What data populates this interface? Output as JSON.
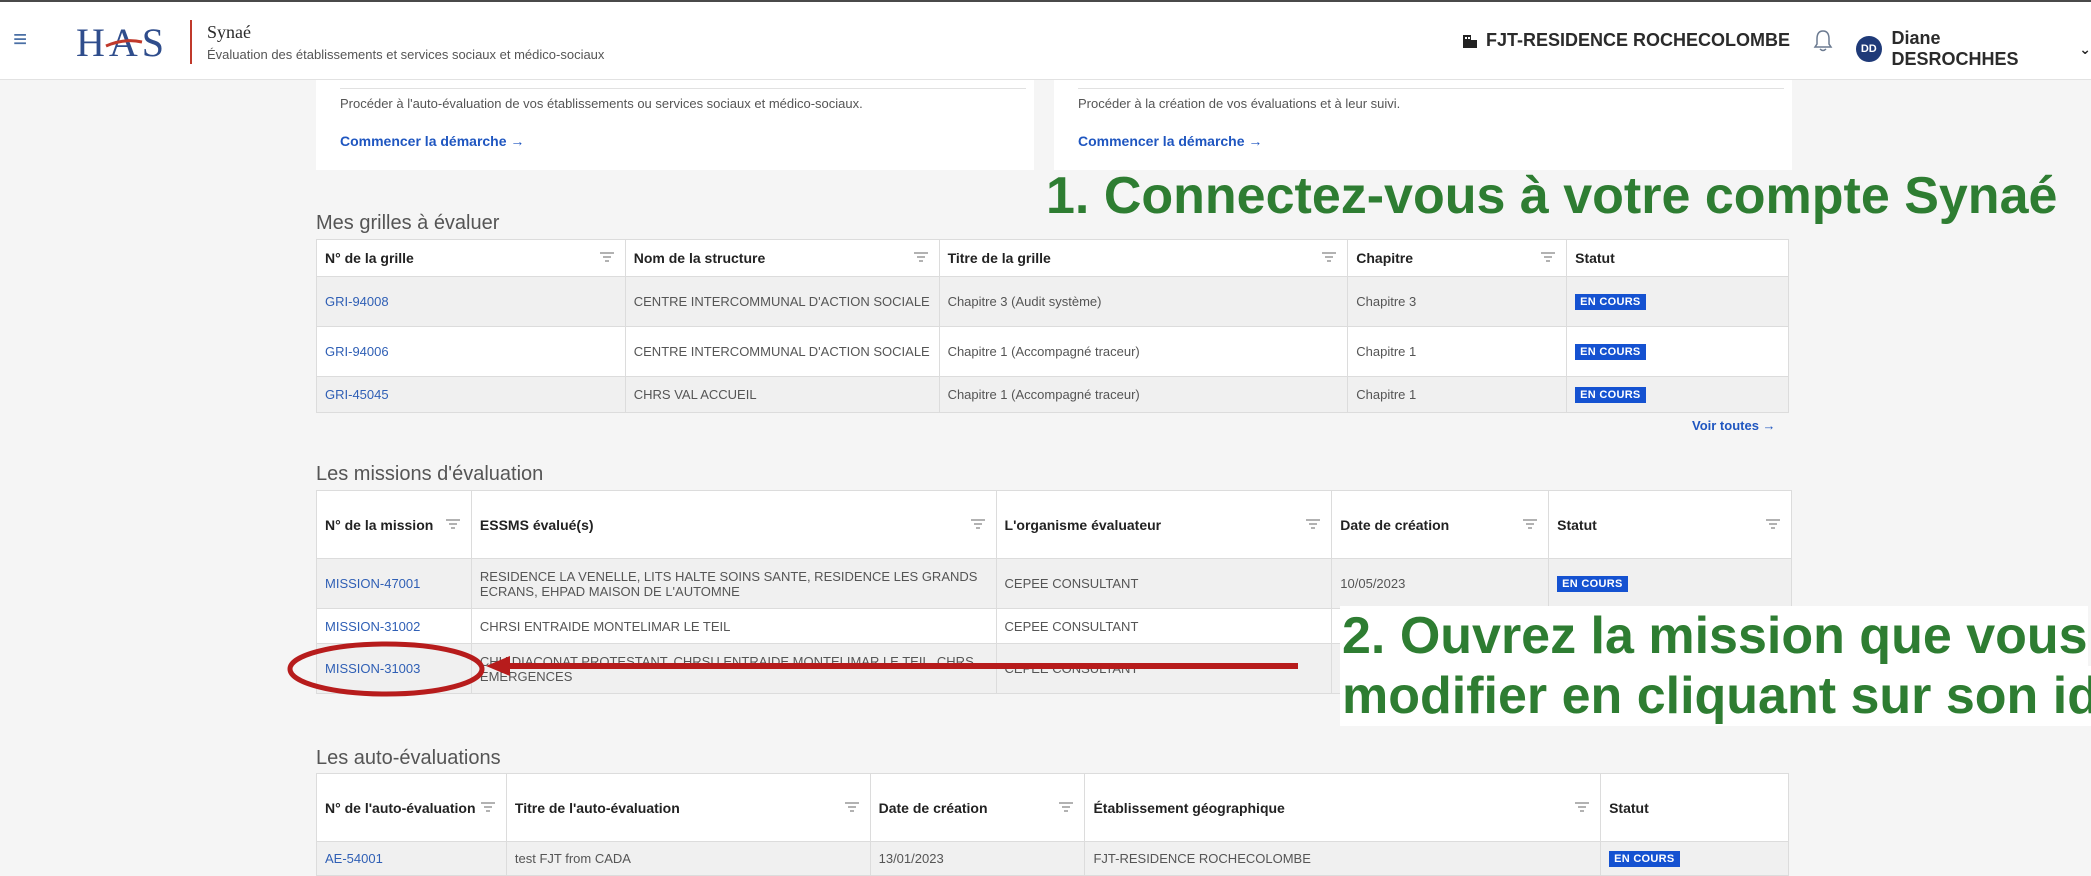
{
  "header": {
    "menu_icon": "hamburger-icon",
    "logo_text": "HAS",
    "app_name": "Synaé",
    "app_subtitle": "Évaluation des établissements et services sociaux et médico-sociaux",
    "org_name": "FJT-RESIDENCE ROCHECOLOMBE",
    "user_initials": "DD",
    "user_name": "Diane DESROCHHES"
  },
  "cards": [
    {
      "description": "Procéder à l'auto-évaluation de vos établissements ou services sociaux et médico-sociaux.",
      "link": "Commencer la démarche →"
    },
    {
      "description": "Procéder à la création de vos évaluations et à leur suivi.",
      "link": "Commencer la démarche →"
    }
  ],
  "grilles": {
    "title": "Mes grilles à évaluer",
    "headers": [
      "N° de la grille",
      "Nom de la structure",
      "Titre de la grille",
      "Chapitre",
      "Statut"
    ],
    "rows": [
      [
        "GRI-94008",
        "CENTRE INTERCOMMUNAL D'ACTION SOCIALE",
        "Chapitre 3 (Audit système)",
        "Chapitre 3",
        "EN COURS"
      ],
      [
        "GRI-94006",
        "CENTRE INTERCOMMUNAL D'ACTION SOCIALE",
        "Chapitre 1 (Accompagné traceur)",
        "Chapitre 1",
        "EN COURS"
      ],
      [
        "GRI-45045",
        "CHRS VAL ACCUEIL",
        "Chapitre 1 (Accompagné traceur)",
        "Chapitre 1",
        "EN COURS"
      ]
    ],
    "voir_toutes": "Voir toutes →"
  },
  "missions": {
    "title": "Les missions d'évaluation",
    "headers": [
      "N° de la mission",
      "ESSMS évalué(s)",
      "L'organisme évaluateur",
      "Date de création",
      "Statut"
    ],
    "rows": [
      [
        "MISSION-47001",
        "RESIDENCE LA VENELLE, LITS HALTE SOINS SANTE, RESIDENCE LES GRANDS ECRANS, EHPAD MAISON DE L'AUTOMNE",
        "CEPEE CONSULTANT",
        "10/05/2023",
        "EN COURS"
      ],
      [
        "MISSION-31002",
        "CHRSI ENTRAIDE MONTELIMAR LE TEIL",
        "CEPEE CONSULTANT",
        "",
        ""
      ],
      [
        "MISSION-31003",
        "CHU DIACONAT PROTESTANT, CHRSU ENTRAIDE MONTELIMAR LE TEIL, CHRS EMERGENCES",
        "CEPEE CONSULTANT",
        "",
        ""
      ]
    ]
  },
  "autoevals": {
    "title": "Les auto-évaluations",
    "headers": [
      "N° de l'auto-évaluation",
      "Titre de l'auto-évaluation",
      "Date de création",
      "Établissement géographique",
      "Statut"
    ],
    "rows": [
      [
        "AE-54001",
        "test FJT from CADA",
        "13/01/2023",
        "FJT-RESIDENCE ROCHECOLOMBE",
        "EN COURS"
      ]
    ]
  },
  "annotations": {
    "step1": "1. Connectez-vous à votre compte Synaé",
    "step2_line1": "2. Ouvrez la mission que vous",
    "step2_line2": "modifier en cliquant sur son id",
    "color": "#2e7d32",
    "marker_color": "#b71c1c"
  }
}
